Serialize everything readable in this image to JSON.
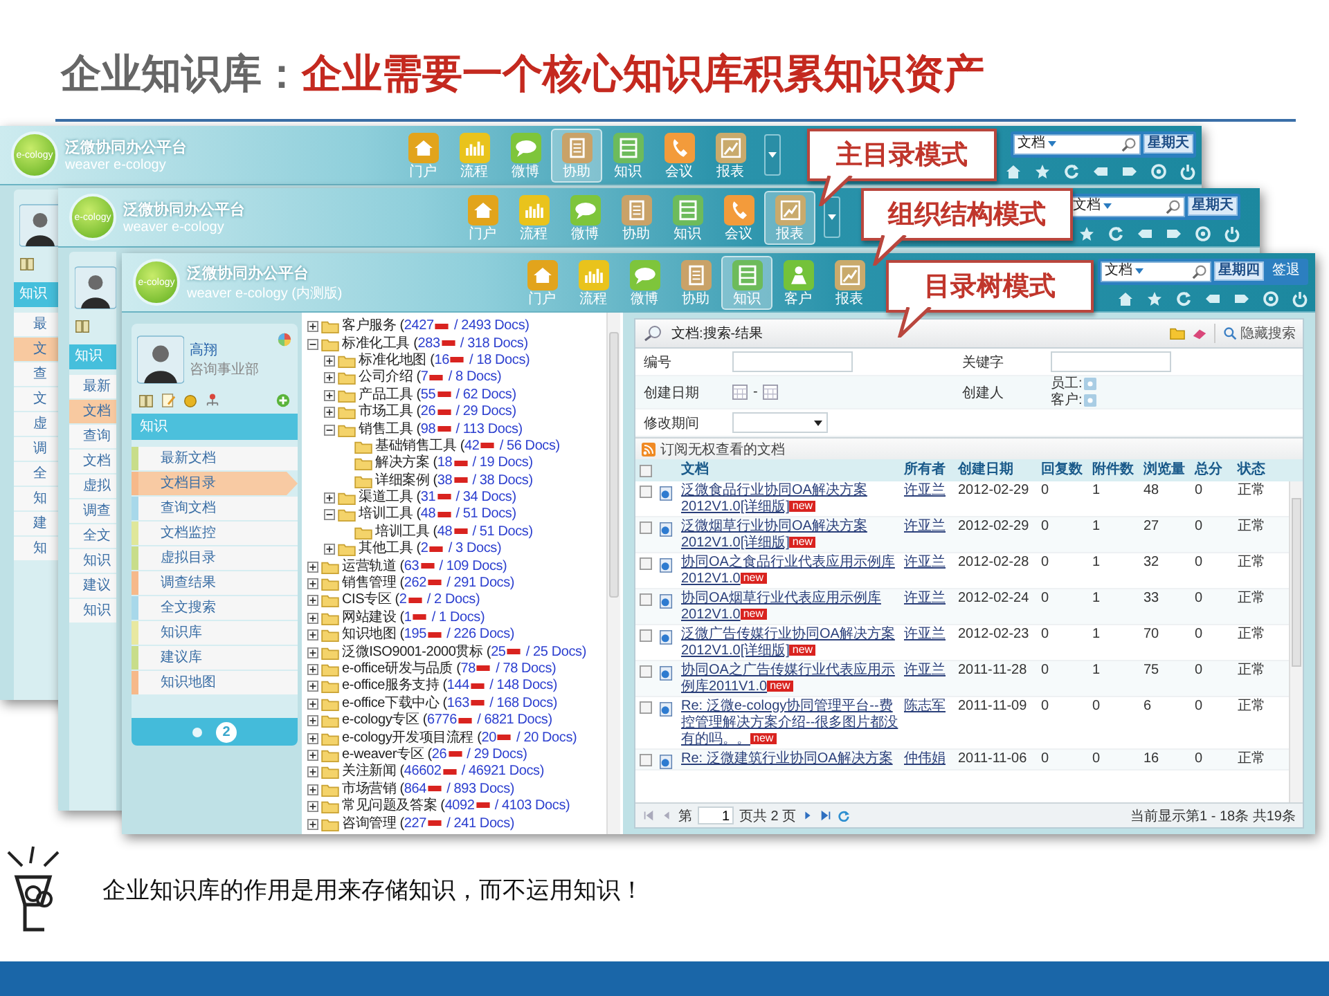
{
  "slide": {
    "title_lead": "企业知识库：",
    "title_main": "企业需要一个核心知识库积累知识资产",
    "caption": "企业知识库的作用是用来存储知识，而不运用知识！"
  },
  "windows": [
    {
      "kind": "back",
      "logo": "e-cology",
      "brand": "泛微协同办公平台",
      "subtitle": "weaver e-cology",
      "callout": "主目录模式",
      "nav": [
        {
          "label": "门户",
          "kind": "home",
          "selected": false
        },
        {
          "label": "流程",
          "kind": "chart",
          "selected": false
        },
        {
          "label": "微博",
          "kind": "chat",
          "selected": false
        },
        {
          "label": "协助",
          "kind": "clipboard",
          "selected": true
        },
        {
          "label": "知识",
          "kind": "list",
          "selected": false
        },
        {
          "label": "会议",
          "kind": "phone",
          "selected": false
        },
        {
          "label": "报表",
          "kind": "report",
          "selected": false
        }
      ],
      "search": {
        "value": "文档",
        "day": "星期天"
      },
      "side_header": "知识",
      "side_items": [
        {
          "label": "最",
          "selected": false
        },
        {
          "label": "文",
          "selected": true
        },
        {
          "label": "查",
          "selected": false
        },
        {
          "label": "文",
          "selected": false
        },
        {
          "label": "虚",
          "selected": false
        },
        {
          "label": "调",
          "selected": false
        },
        {
          "label": "全",
          "selected": false
        },
        {
          "label": "知",
          "selected": false
        },
        {
          "label": "建",
          "selected": false
        },
        {
          "label": "知",
          "selected": false
        }
      ]
    },
    {
      "kind": "back",
      "logo": "e-cology",
      "brand": "泛微协同办公平台",
      "subtitle": "weaver e-cology",
      "callout": "组织结构模式",
      "nav": [
        {
          "label": "门户",
          "kind": "home",
          "selected": false
        },
        {
          "label": "流程",
          "kind": "chart",
          "selected": false
        },
        {
          "label": "微博",
          "kind": "chat",
          "selected": false
        },
        {
          "label": "协助",
          "kind": "clipboard",
          "selected": false
        },
        {
          "label": "知识",
          "kind": "list",
          "selected": false
        },
        {
          "label": "会议",
          "kind": "phone",
          "selected": false
        },
        {
          "label": "报表",
          "kind": "report",
          "selected": true
        }
      ],
      "search": {
        "value": "文档",
        "day": "星期天"
      },
      "side_header": "知识",
      "side_items": [
        {
          "label": "最新",
          "selected": false
        },
        {
          "label": "文档",
          "selected": true
        },
        {
          "label": "查询",
          "selected": false
        },
        {
          "label": "文档",
          "selected": false
        },
        {
          "label": "虚拟",
          "selected": false
        },
        {
          "label": "调查",
          "selected": false
        },
        {
          "label": "全文",
          "selected": false
        },
        {
          "label": "知识",
          "selected": false
        },
        {
          "label": "建议",
          "selected": false
        },
        {
          "label": "知识",
          "selected": false
        }
      ]
    },
    {
      "kind": "front",
      "logo": "e-cology",
      "brand": "泛微协同办公平台",
      "subtitle": "weaver e-cology (内测版)",
      "callout": "目录树模式",
      "nav": [
        {
          "label": "门户",
          "kind": "home",
          "selected": false
        },
        {
          "label": "流程",
          "kind": "chart",
          "selected": false
        },
        {
          "label": "微博",
          "kind": "chat",
          "selected": false
        },
        {
          "label": "协助",
          "kind": "clipboard",
          "selected": false
        },
        {
          "label": "知识",
          "kind": "list",
          "selected": true
        },
        {
          "label": "客户",
          "kind": "customer",
          "selected": false
        },
        {
          "label": "报表",
          "kind": "report",
          "selected": false
        }
      ],
      "search": {
        "value": "文档",
        "day": "星期四",
        "logout": "签退"
      },
      "user": {
        "name": "高翔",
        "dept": "咨询事业部"
      },
      "side_header": "知识",
      "menu": [
        {
          "label": "最新文档",
          "color": "#c8dd8a",
          "selected": false
        },
        {
          "label": "文档目录",
          "color": "#f6b98a",
          "selected": true
        },
        {
          "label": "查询文档",
          "color": "#a8d8ea",
          "selected": false
        },
        {
          "label": "文档监控",
          "color": "#dfe79a",
          "selected": false
        },
        {
          "label": "虚拟目录",
          "color": "#c8dd8a",
          "selected": false
        },
        {
          "label": "调查结果",
          "color": "#f6b98a",
          "selected": false
        },
        {
          "label": "全文搜索",
          "color": "#a8d8ea",
          "selected": false
        },
        {
          "label": "知识库",
          "color": "#e8e8a0",
          "selected": false
        },
        {
          "label": "建议库",
          "color": "#c8dd8a",
          "selected": false
        },
        {
          "label": "知识地图",
          "color": "#f6b98a",
          "selected": false
        }
      ],
      "menu_page": "2",
      "tree": [
        {
          "name": "客户服务 (",
          "count": "2427",
          "total": "/ 2493 Docs)",
          "expanded": false
        },
        {
          "name": "标准化工具 (",
          "count": "283",
          "total": "/ 318 Docs)",
          "expanded": true,
          "children": [
            {
              "name": "标准化地图 (",
              "count": "16",
              "total": "/ 18 Docs)",
              "expanded": false
            },
            {
              "name": "公司介绍 (",
              "count": "7",
              "total": "/ 8 Docs)",
              "expanded": false
            },
            {
              "name": "产品工具 (",
              "count": "55",
              "total": "/ 62 Docs)",
              "expanded": false
            },
            {
              "name": "市场工具 (",
              "count": "26",
              "total": "/ 29 Docs)",
              "expanded": false
            },
            {
              "name": "销售工具 (",
              "count": "98",
              "total": "/ 113 Docs)",
              "expanded": true,
              "children": [
                {
                  "name": "基础销售工具 (",
                  "count": "42",
                  "total": "/ 56 Docs)"
                },
                {
                  "name": "解决方案 (",
                  "count": "18",
                  "total": "/ 19 Docs)"
                },
                {
                  "name": "详细案例 (",
                  "count": "38",
                  "total": "/ 38 Docs)"
                }
              ]
            },
            {
              "name": "渠道工具 (",
              "count": "31",
              "total": "/ 34 Docs)",
              "expanded": false
            },
            {
              "name": "培训工具 (",
              "count": "48",
              "total": "/ 51 Docs)",
              "expanded": true,
              "children": [
                {
                  "name": "培训工具 (",
                  "count": "48",
                  "total": "/ 51 Docs)"
                }
              ]
            },
            {
              "name": "其他工具 (",
              "count": "2",
              "total": "/ 3 Docs)",
              "expanded": false
            }
          ]
        },
        {
          "name": "运营轨道 (",
          "count": "63",
          "total": "/ 109 Docs)",
          "expanded": false
        },
        {
          "name": "销售管理 (",
          "count": "262",
          "total": "/ 291 Docs)",
          "expanded": false
        },
        {
          "name": "CIS专区 (",
          "count": "2",
          "total": "/ 2 Docs)",
          "expanded": false
        },
        {
          "name": "网站建设 (",
          "count": "1",
          "total": "/ 1 Docs)",
          "expanded": false
        },
        {
          "name": "知识地图 (",
          "count": "195",
          "total": "/ 226 Docs)",
          "expanded": false
        },
        {
          "name": "泛微ISO9001-2000贯标 (",
          "count": "25",
          "total": "/ 25 Docs)",
          "expanded": false
        },
        {
          "name": "e-office研发与品质 (",
          "count": "78",
          "total": "/ 78 Docs)",
          "expanded": false
        },
        {
          "name": "e-office服务支持 (",
          "count": "144",
          "total": "/ 148 Docs)",
          "expanded": false
        },
        {
          "name": "e-office下载中心 (",
          "count": "163",
          "total": "/ 168 Docs)",
          "expanded": false
        },
        {
          "name": "e-cology专区 (",
          "count": "6776",
          "total": "/ 6821 Docs)",
          "expanded": false
        },
        {
          "name": "e-cology开发项目流程 (",
          "count": "20",
          "total": "/ 20 Docs)",
          "expanded": false
        },
        {
          "name": "e-weaver专区 (",
          "count": "26",
          "total": "/ 29 Docs)",
          "expanded": false
        },
        {
          "name": "关注新闻 (",
          "count": "46602",
          "total": "/ 46921 Docs)",
          "expanded": false
        },
        {
          "name": "市场营销 (",
          "count": "864",
          "total": "/ 893 Docs)",
          "expanded": false
        },
        {
          "name": "常见问题及答案 (",
          "count": "4092",
          "total": "/ 4103 Docs)",
          "expanded": false
        },
        {
          "name": "咨询管理 (",
          "count": "227",
          "total": "/ 241 Docs)",
          "expanded": false
        }
      ],
      "results": {
        "title": "文档:搜索-结果",
        "hide_search": "隐藏搜索",
        "form": {
          "number": "编号",
          "keyword": "关键字",
          "created": "创建日期",
          "separator": "-",
          "creator": "创建人",
          "employee": "员工:",
          "customer": "客户:",
          "modified": "修改期间"
        },
        "subscribe": "订阅无权查看的文档",
        "columns": [
          "文档",
          "所有者",
          "创建日期",
          "回复数",
          "附件数",
          "浏览量",
          "总分",
          "状态"
        ],
        "all_checked": false,
        "rows": [
          {
            "title": "泛微食品行业协同OA解决方案2012V1.0[详细版]",
            "badge": "new",
            "owner": "许亚兰",
            "date": "2012-02-29",
            "replies": "0",
            "attachments": "1",
            "views": "48",
            "score": "0",
            "status": "正常",
            "checked": false
          },
          {
            "title": "泛微烟草行业协同OA解决方案2012V1.0[详细版]",
            "badge": "new",
            "owner": "许亚兰",
            "date": "2012-02-29",
            "replies": "0",
            "attachments": "1",
            "views": "27",
            "score": "0",
            "status": "正常",
            "checked": false
          },
          {
            "title": "协同OA之食品行业代表应用示例库2012V1.0",
            "badge": "new",
            "owner": "许亚兰",
            "date": "2012-02-28",
            "replies": "0",
            "attachments": "1",
            "views": "32",
            "score": "0",
            "status": "正常",
            "checked": false
          },
          {
            "title": "协同OA烟草行业代表应用示例库2012V1.0",
            "badge": "new",
            "owner": "许亚兰",
            "date": "2012-02-24",
            "replies": "0",
            "attachments": "1",
            "views": "33",
            "score": "0",
            "status": "正常",
            "checked": false
          },
          {
            "title": "泛微广告传媒行业协同OA解决方案2012V1.0[详细版]",
            "badge": "new",
            "owner": "许亚兰",
            "date": "2012-02-23",
            "replies": "0",
            "attachments": "1",
            "views": "70",
            "score": "0",
            "status": "正常",
            "checked": false
          },
          {
            "title": "协同OA之广告传媒行业代表应用示例库2011V1.0",
            "badge": "new",
            "owner": "许亚兰",
            "date": "2011-11-28",
            "replies": "0",
            "attachments": "1",
            "views": "75",
            "score": "0",
            "status": "正常",
            "checked": false
          },
          {
            "title": "Re: 泛微e-cology协同管理平台--费控管理解决方案介绍--很多图片都没有的吗。。",
            "badge": "new",
            "owner": "陈志军",
            "date": "2011-11-09",
            "replies": "0",
            "attachments": "0",
            "views": "6",
            "score": "0",
            "status": "正常",
            "checked": false
          },
          {
            "title": "Re: 泛微建筑行业协同OA解决方案",
            "owner": "仲伟娟",
            "date": "2011-11-06",
            "replies": "0",
            "attachments": "0",
            "views": "16",
            "score": "0",
            "status": "正常",
            "checked": false
          }
        ],
        "pager": {
          "page_prefix": "第",
          "page": "1",
          "page_suffix": "页共 2 页",
          "summary": "当前显示第1 - 18条 共19条"
        }
      }
    }
  ]
}
